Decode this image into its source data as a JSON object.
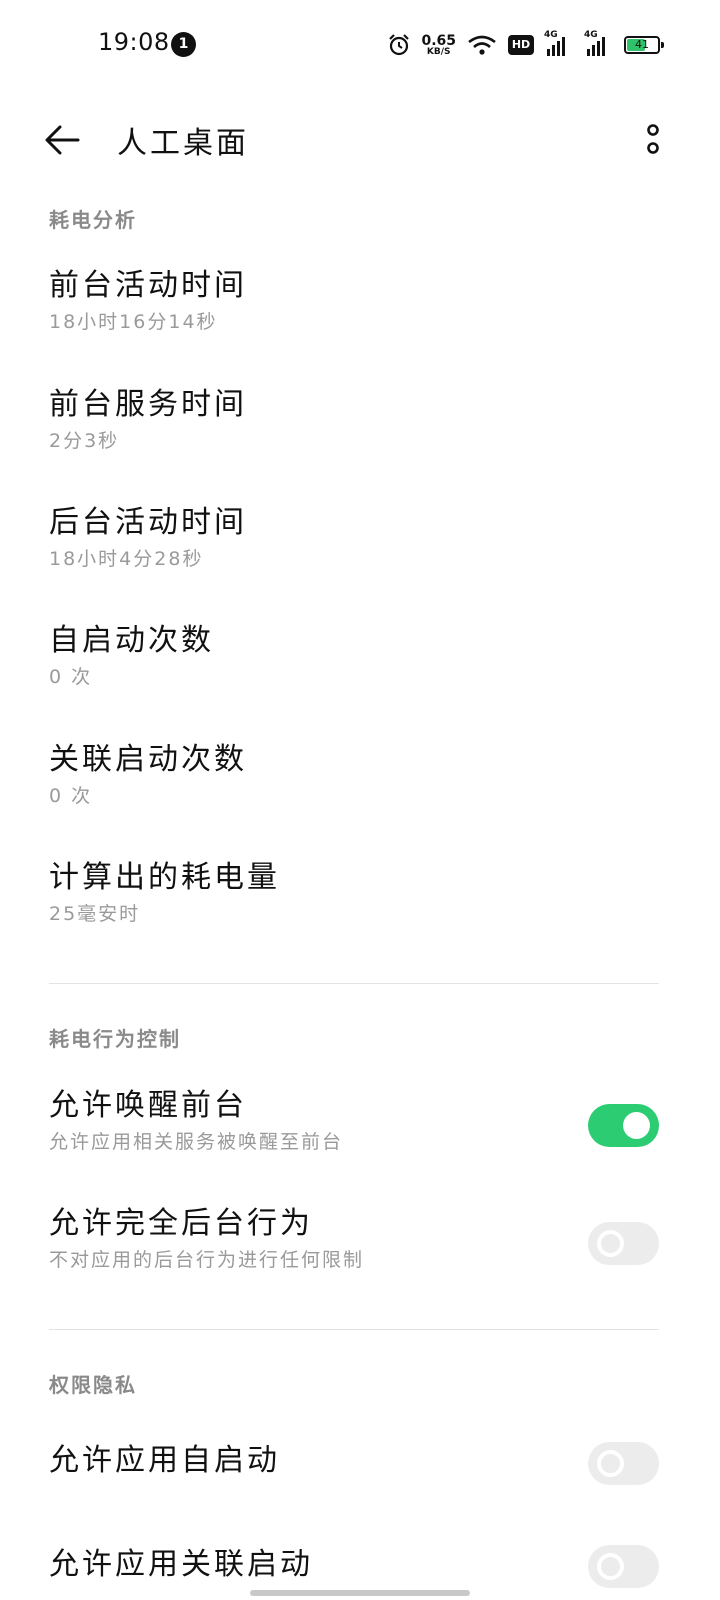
{
  "status_bar": {
    "time": "19:08",
    "notification_count": "1",
    "net_speed_value": "0.65",
    "net_speed_unit": "KB/S",
    "hd_badge": "HD",
    "signal1_label": "4G",
    "signal2_label": "4G",
    "battery_level": "41"
  },
  "app_bar": {
    "title": "人工桌面",
    "back_icon": "arrow-left-icon",
    "more_icon": "more-vertical-icon"
  },
  "sections": {
    "power_analysis": {
      "header": "耗电分析",
      "items": [
        {
          "title": "前台活动时间",
          "subtitle": "18小时16分14秒"
        },
        {
          "title": "前台服务时间",
          "subtitle": "2分3秒"
        },
        {
          "title": "后台活动时间",
          "subtitle": "18小时4分28秒"
        },
        {
          "title": "自启动次数",
          "subtitle": "0 次"
        },
        {
          "title": "关联启动次数",
          "subtitle": "0 次"
        },
        {
          "title": "计算出的耗电量",
          "subtitle": "25毫安时"
        }
      ]
    },
    "behavior_control": {
      "header": "耗电行为控制",
      "items": [
        {
          "title": "允许唤醒前台",
          "subtitle": "允许应用相关服务被唤醒至前台",
          "enabled": true
        },
        {
          "title": "允许完全后台行为",
          "subtitle": "不对应用的后台行为进行任何限制",
          "enabled": false
        }
      ]
    },
    "privacy": {
      "header": "权限隐私",
      "items": [
        {
          "title": "允许应用自启动",
          "enabled": false
        },
        {
          "title": "允许应用关联启动",
          "enabled": false
        }
      ]
    }
  },
  "colors": {
    "toggle_on": "#2ccd72",
    "toggle_off": "#ececec",
    "header_text": "#8a8a8a",
    "subtitle_text": "#9a9a9a"
  }
}
